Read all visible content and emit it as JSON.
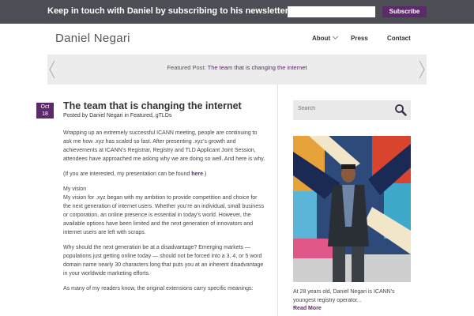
{
  "newsletter": {
    "message": "Keep in touch with Daniel by subscribing to his newsletter:",
    "email_placeholder": "",
    "subscribe_label": "Subscribe"
  },
  "header": {
    "site_title": "Daniel Negari",
    "nav": {
      "about": "About",
      "press": "Press",
      "contact": "Contact"
    }
  },
  "featured": {
    "prefix": "Featured Post:",
    "link": "The team that is changing the internet"
  },
  "post": {
    "date_month": "Oct",
    "date_day": "18",
    "title": "The team that is changing the internet",
    "meta_prefix": "Posted by ",
    "meta_author": "Daniel Negari",
    "meta_mid": " in ",
    "meta_categories": "Featured, gTLDs",
    "p1": "Wrapping up an extremely successful ICANN meeting, people are continuing to ask me how .xyz has scaled so fast. After presenting .xyz’s growth and achievements at ICANN’s Registrar, Registry and TLD Applicant Joint Session, attendees have approached me asking why we are doing so well. And here is why.",
    "p2_prefix": "(If you are interested, my presentation can be found ",
    "p2_link": "here",
    "p2_suffix": ".)",
    "vision_heading": "My vision",
    "p3": "My vision for .xyz began with my ambition to provide competition and choice for the next generation of internet users. Whether you’re an individual, small business or corporation, an online presence is essential in today’s world. However, the available options have been limited and the next generation of innovators and internet users are left with scraps.",
    "p4": " Why should the next generation be at a disadvantage? Emerging markets — populations just getting online today — should not be forced into a 3, 4, or 5 word domain name nearly 30 characters long that puts you at an inherent disadvantage in your worldwide marketing efforts.",
    "p5": "As many of my readers know, the original extensions carry specific meanings:"
  },
  "sidebar": {
    "search_placeholder": "Search",
    "caption": "At 28 years old, Daniel Negari is ICANN's youngest registry operator...",
    "read_more": "Read More"
  },
  "colors": {
    "accent": "#5c2a6b",
    "newsbar_bg": "#4d4d55",
    "banner_bg": "#ececec"
  }
}
